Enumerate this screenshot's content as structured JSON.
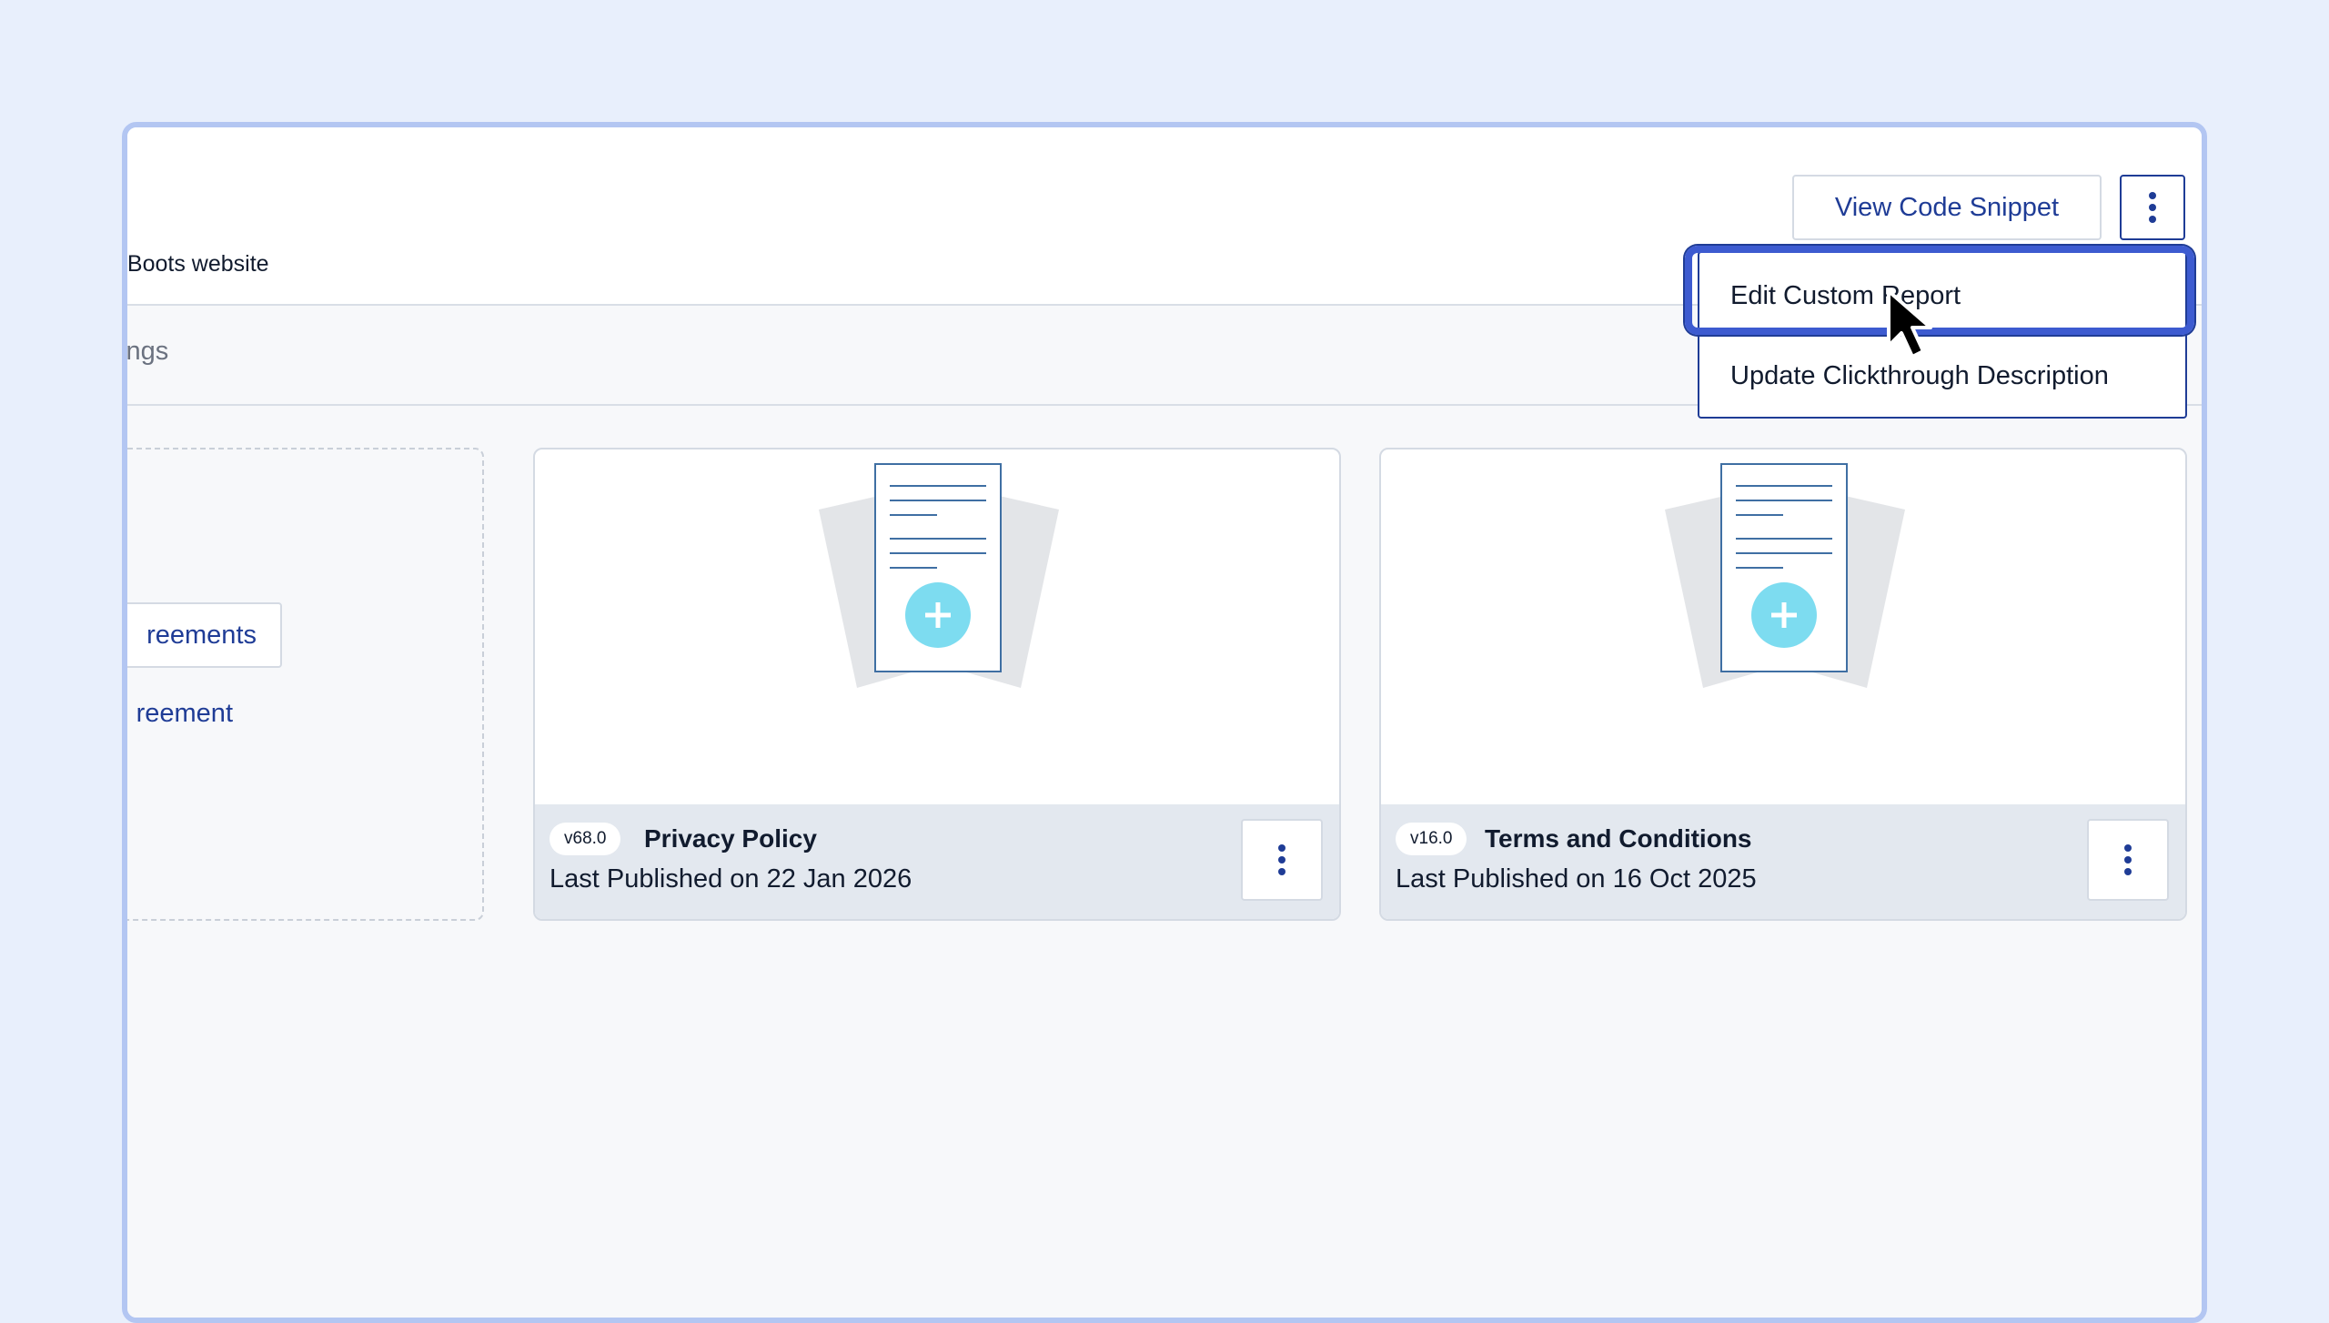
{
  "header": {
    "subtitle": "gBoots website",
    "view_code_snippet_label": "View Code Snippet",
    "more_options_icon": "vertical-ellipsis-icon"
  },
  "tabs": {
    "visible_label": "tings"
  },
  "dropdown_menu": {
    "items": [
      {
        "label": "Edit Custom Report",
        "highlighted": true
      },
      {
        "label": "Update Clickthrough Description",
        "highlighted": false
      }
    ]
  },
  "left_panel": {
    "agreements_button_label": "reements",
    "agreement_link_label": "reement"
  },
  "documents": [
    {
      "version": "v68.0",
      "title": "Privacy Policy",
      "published": "Last Published on 22 Jan 2026",
      "icon": "document-add-icon"
    },
    {
      "version": "v16.0",
      "title": "Terms and Conditions",
      "published": "Last Published on 16 Oct 2025",
      "icon": "document-add-icon"
    }
  ],
  "colors": {
    "accent": "#1f3c96",
    "highlight_ring": "#3d5bd0",
    "plus_circle": "#7ddcf0",
    "page_background": "#e8effc",
    "frame_border": "#b3c6f2"
  }
}
